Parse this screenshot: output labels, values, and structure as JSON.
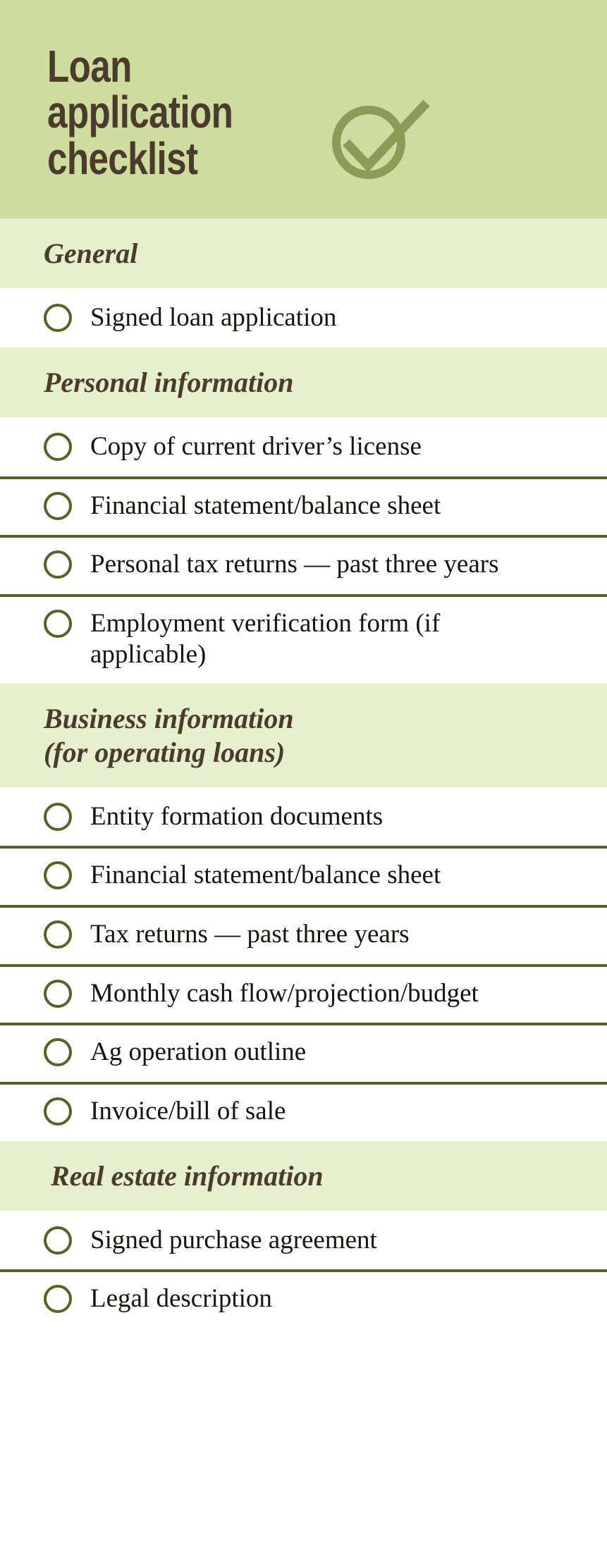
{
  "document": {
    "title": "Loan application checklist",
    "title_lines": "Loan application\nchecklist"
  },
  "colors": {
    "header_background": "#cedca0",
    "section_background": "#e7f0ce",
    "title_text": "#4a3b2c",
    "item_text": "#15140f",
    "rule": "#556225",
    "checkbox_outline": "#566326",
    "check_icon": "#8a9c55",
    "page_background": "#ffffff"
  },
  "icons": {
    "header_check": "circle-check-icon",
    "item_checkbox": "empty-circle-checkbox-icon"
  },
  "sections": [
    {
      "title": "General",
      "items": [
        "Signed loan application"
      ]
    },
    {
      "title": "Personal information",
      "items": [
        "Copy of current driver’s license",
        "Financial statement/balance sheet",
        "Personal tax returns — past three years",
        "Employment verification form (if applicable)"
      ]
    },
    {
      "title": "Business information\n(for operating loans)",
      "items": [
        "Entity formation documents",
        "Financial statement/balance sheet",
        "Tax returns — past three years",
        "Monthly cash flow/projection/budget",
        "Ag operation outline",
        "Invoice/bill of sale"
      ]
    },
    {
      "title": "Real estate information",
      "items": [
        "Signed purchase agreement",
        "Legal description"
      ]
    }
  ]
}
